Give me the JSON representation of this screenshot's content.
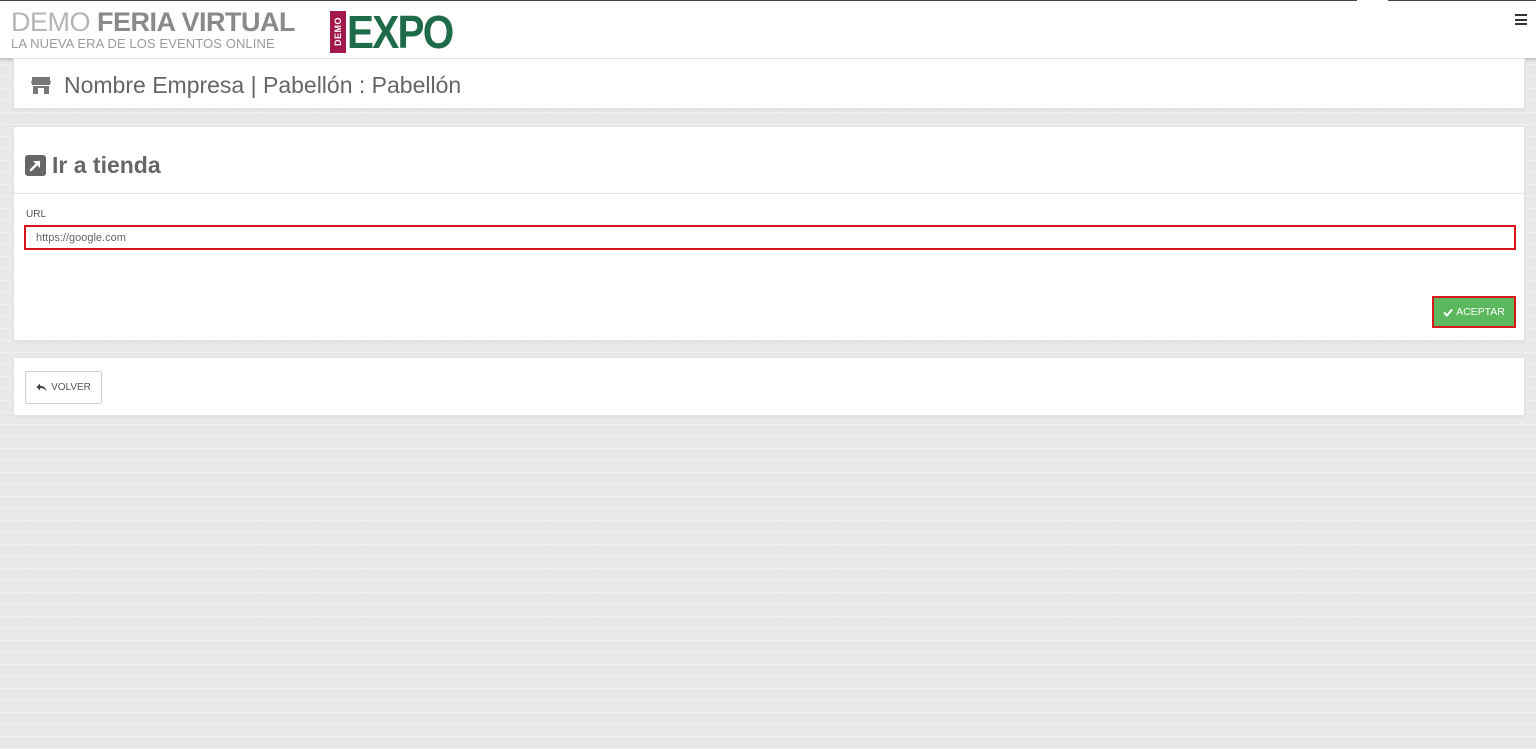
{
  "header": {
    "brand_demo": "DEMO ",
    "brand_name": "FERIA VIRTUAL",
    "tagline": "LA NUEVA ERA DE LOS EVENTOS ONLINE",
    "logo_badge": "DEMO",
    "logo_text": "EXPO",
    "menu_icon": "hamburger-menu-icon"
  },
  "page": {
    "title": "Nombre Empresa | Pabellón : Pabellón",
    "title_icon": "store-icon"
  },
  "form": {
    "section_title": "Ir a tienda",
    "section_icon": "external-link-icon",
    "url_label": "URL",
    "url_value": "https://google.com",
    "submit_label": "ACEPTAR",
    "submit_icon": "check-icon"
  },
  "footer": {
    "back_label": "VOLVER",
    "back_icon": "reply-icon"
  },
  "colors": {
    "accept_button": "#5cb85c",
    "highlight_border": "#d9141b",
    "logo_green": "#1e6b4a",
    "logo_badge": "#a3184a"
  }
}
